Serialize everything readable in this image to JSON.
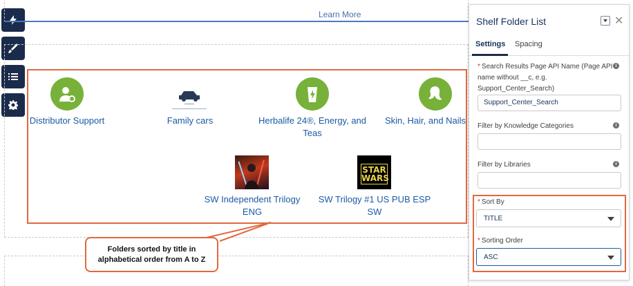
{
  "toolbar": {
    "items": [
      {
        "icon": "lightning-icon"
      },
      {
        "icon": "brush-icon"
      },
      {
        "icon": "list-icon"
      },
      {
        "icon": "gear-icon"
      }
    ]
  },
  "canvas": {
    "learn_more": "Learn More",
    "folders": [
      {
        "label_lines": [
          "Distributor Support"
        ],
        "icon": "person-gear-icon"
      },
      {
        "label_lines": [
          "Family cars"
        ],
        "icon": "car-thumbnail"
      },
      {
        "label_lines": [
          "Herbalife 24®, Energy, and",
          "Teas"
        ],
        "icon": "drink-bolt-icon"
      },
      {
        "label_lines": [
          "Skin, Hair, and Nails P"
        ],
        "icon": "hair-icon"
      },
      {
        "label_lines": [
          "SW Independent Trilogy",
          "ENG"
        ],
        "icon": "movie-poster-thumbnail"
      },
      {
        "label_lines": [
          "SW Trilogy #1 US PUB ESP",
          "SW"
        ],
        "icon": "star-wars-logo-thumbnail"
      }
    ],
    "callout_lines": [
      "Folders sorted by title in",
      "alphabetical order from A to Z"
    ]
  },
  "panel": {
    "title": "Shelf Folder List",
    "tabs": [
      "Settings",
      "Spacing"
    ],
    "fields": {
      "search_label_lines": [
        "Search Results Page API Name (Page API",
        "name without __c, e.g.",
        "Support_Center_Search)"
      ],
      "search_value": "Support_Center_Search",
      "knowledge_label": "Filter by Knowledge Categories",
      "knowledge_value": "",
      "libraries_label": "Filter by Libraries",
      "libraries_value": "",
      "sort_by_label": "Sort By",
      "sort_by_value": "TITLE",
      "sort_order_label": "Sorting Order",
      "sort_order_value": "ASC"
    }
  },
  "colors": {
    "accent_orange": "#e0683e",
    "toolbar_navy": "#1b2b4b",
    "icon_green": "#77b13a",
    "link_blue": "#1b5aa3"
  }
}
